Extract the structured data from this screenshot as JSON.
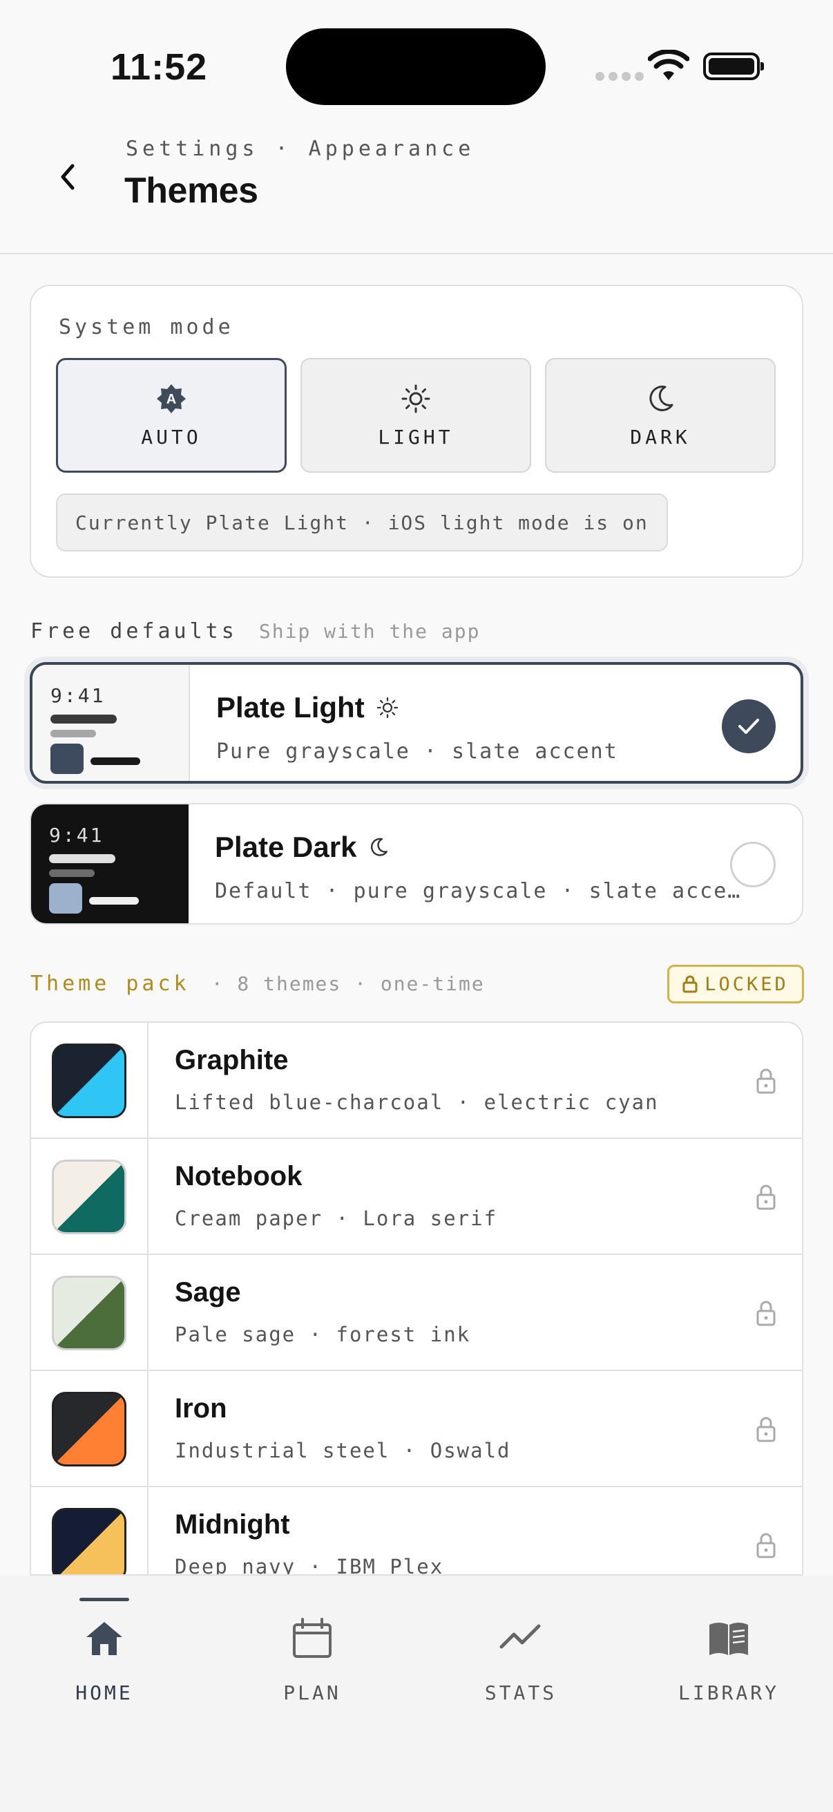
{
  "status": {
    "time": "11:52"
  },
  "header": {
    "breadcrumb": "Settings · Appearance",
    "title": "Themes"
  },
  "system_mode": {
    "label": "System mode",
    "options": [
      {
        "label": "AUTO",
        "icon": "auto-brightness-icon",
        "selected": true
      },
      {
        "label": "LIGHT",
        "icon": "sun-icon",
        "selected": false
      },
      {
        "label": "DARK",
        "icon": "moon-icon",
        "selected": false
      }
    ],
    "note": "Currently Plate Light · iOS light mode is on"
  },
  "free_defaults": {
    "title": "Free defaults",
    "subtitle": "Ship with the app",
    "themes": [
      {
        "name": "Plate Light",
        "icon": "sun-icon",
        "desc": "Pure grayscale · slate accent",
        "preview_time": "9:41",
        "selected": true
      },
      {
        "name": "Plate Dark",
        "icon": "moon-icon",
        "desc": "Default · pure grayscale · slate acce…",
        "preview_time": "9:41",
        "selected": false
      }
    ]
  },
  "theme_pack": {
    "title": "Theme pack",
    "subtitle": "· 8 themes · one-time",
    "badge": "LOCKED",
    "themes": [
      {
        "name": "Graphite",
        "desc": "Lifted blue-charcoal · electric cyan",
        "colors": [
          "#1c2330",
          "#2fc6f6"
        ]
      },
      {
        "name": "Notebook",
        "desc": "Cream paper · Lora serif",
        "colors": [
          "#f4efe6",
          "#0f6b62"
        ]
      },
      {
        "name": "Sage",
        "desc": "Pale sage · forest ink",
        "colors": [
          "#e6ebe2",
          "#4c6e3a"
        ]
      },
      {
        "name": "Iron",
        "desc": "Industrial steel · Oswald",
        "colors": [
          "#26282c",
          "#ff7f33"
        ]
      },
      {
        "name": "Midnight",
        "desc": "Deep navy · IBM Plex",
        "colors": [
          "#141d33",
          "#f6c15a"
        ]
      }
    ]
  },
  "tabs": [
    {
      "label": "HOME",
      "icon": "home-icon",
      "active": true
    },
    {
      "label": "PLAN",
      "icon": "calendar-icon",
      "active": false
    },
    {
      "label": "STATS",
      "icon": "trend-icon",
      "active": false
    },
    {
      "label": "LIBRARY",
      "icon": "book-icon",
      "active": false
    }
  ]
}
